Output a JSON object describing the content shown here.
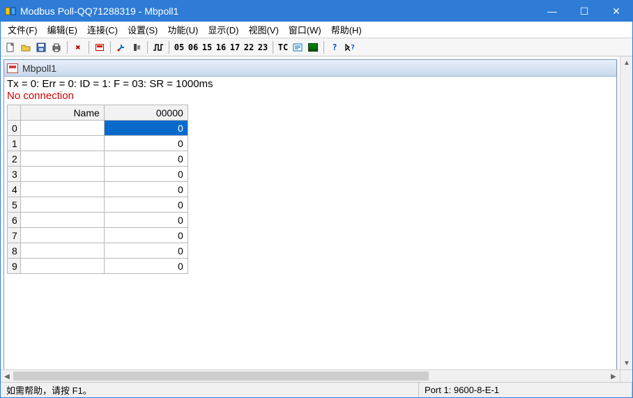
{
  "titlebar": {
    "icon_name": "modbus-poll-icon",
    "title": "Modbus Poll-QQ71288319 - Mbpoll1"
  },
  "win_controls": {
    "min": "—",
    "max": "☐",
    "close": "✕"
  },
  "menubar": [
    "文件(F)",
    "编辑(E)",
    "连接(C)",
    "设置(S)",
    "功能(U)",
    "显示(D)",
    "视图(V)",
    "窗口(W)",
    "帮助(H)"
  ],
  "toolbar": {
    "numeric_buttons": [
      "05",
      "06",
      "15",
      "16",
      "17",
      "22",
      "23"
    ],
    "tc_label": "TC"
  },
  "child_window": {
    "title": "Mbpoll1",
    "status_line": "Tx = 0: Err = 0: ID = 1: F = 03: SR = 1000ms",
    "no_connection": "No connection",
    "columns": {
      "name": "Name",
      "value": "00000"
    },
    "rows": [
      {
        "idx": "0",
        "name": "",
        "value": "0",
        "selected": true
      },
      {
        "idx": "1",
        "name": "",
        "value": "0",
        "selected": false
      },
      {
        "idx": "2",
        "name": "",
        "value": "0",
        "selected": false
      },
      {
        "idx": "3",
        "name": "",
        "value": "0",
        "selected": false
      },
      {
        "idx": "4",
        "name": "",
        "value": "0",
        "selected": false
      },
      {
        "idx": "5",
        "name": "",
        "value": "0",
        "selected": false
      },
      {
        "idx": "6",
        "name": "",
        "value": "0",
        "selected": false
      },
      {
        "idx": "7",
        "name": "",
        "value": "0",
        "selected": false
      },
      {
        "idx": "8",
        "name": "",
        "value": "0",
        "selected": false
      },
      {
        "idx": "9",
        "name": "",
        "value": "0",
        "selected": false
      }
    ]
  },
  "statusbar": {
    "help_hint": "如需帮助，请按 F1。",
    "port_info": "Port 1: 9600-8-E-1"
  }
}
